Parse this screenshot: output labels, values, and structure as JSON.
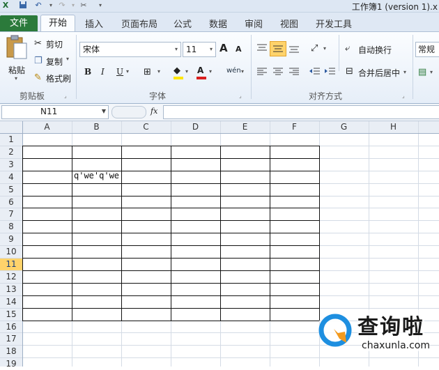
{
  "window": {
    "title": "工作簿1 (version 1).x"
  },
  "tabs": {
    "file": "文件",
    "items": [
      "开始",
      "插入",
      "页面布局",
      "公式",
      "数据",
      "审阅",
      "视图",
      "开发工具"
    ]
  },
  "clipboard": {
    "paste": "粘贴",
    "cut": "剪切",
    "copy": "复制",
    "format_painter": "格式刷",
    "group_label": "剪贴板"
  },
  "font": {
    "name": "宋体",
    "size": "11",
    "group_label": "字体",
    "bold": "B",
    "italic": "I",
    "underline": "U",
    "grow": "A",
    "shrink": "A",
    "font_color": "A",
    "phonetic": "wén"
  },
  "alignment": {
    "wrap_text": "自动换行",
    "merge_center": "合并后居中",
    "group_label": "对齐方式"
  },
  "number": {
    "format": "常规"
  },
  "formula_bar": {
    "name_box": "N11",
    "fx": "fx",
    "value": ""
  },
  "sheet": {
    "columns": [
      "A",
      "B",
      "C",
      "D",
      "E",
      "F",
      "G",
      "H"
    ],
    "rows": [
      "1",
      "2",
      "3",
      "4",
      "5",
      "6",
      "7",
      "8",
      "9",
      "10",
      "11",
      "12",
      "13",
      "14",
      "15",
      "16",
      "17",
      "18",
      "19"
    ],
    "active_row": "11",
    "cells": {
      "B4": "q'we'q'we"
    }
  },
  "watermark": {
    "brand": "查询啦",
    "url": "chaxunla.com"
  },
  "colors": {
    "file_tab": "#2b7a3b",
    "accent": "#ffc83d",
    "watermark_blue": "#1e8fe0",
    "watermark_orange": "#f39a1e"
  }
}
